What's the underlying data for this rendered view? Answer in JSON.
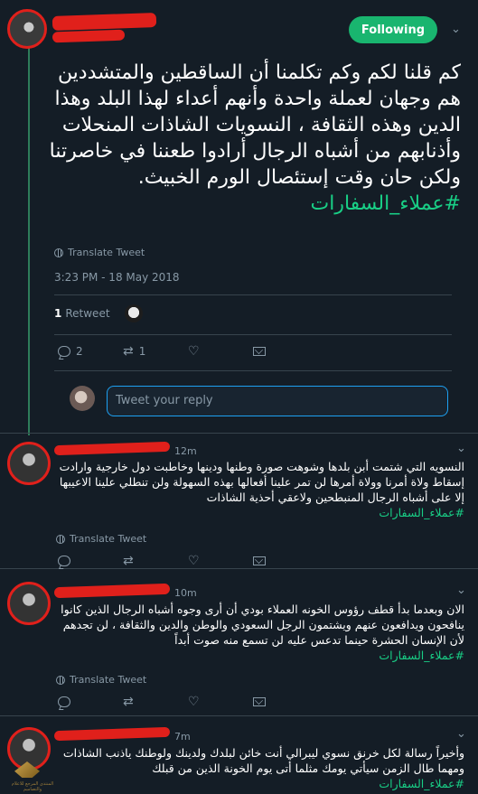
{
  "main_tweet": {
    "follow_label": "Following",
    "text": "كم قلنا لكم وكم تكلمنا أن الساقطين والمتشددين هم وجهان لعملة واحدة وأنهم أعداء لهذا البلد وهذا الدين وهذه الثقافة ، النسويات الشاذات المنحلات وأذنابهم من أشباه الرجال أرادوا طعننا في خاصرتنا ولكن حان وقت إستئصال الورم الخبيث.",
    "hashtag": "#عملاء_السفارات",
    "translate_label": "Translate Tweet",
    "timestamp": "3:23 PM - 18 May 2018",
    "retweet_count": "1",
    "retweet_label": "Retweet",
    "reply_count": "2",
    "retweet_action_count": "1",
    "reply_placeholder": "Tweet your reply"
  },
  "replies": [
    {
      "time": "12m",
      "text": "النسويه التي شتمت أبن بلدها وشوهت صورة وطنها ودينها وخاطبت دول خارجية وارادت إسقاط ولاة أمرنا وولاة أمرها لن تمر علينا أفعالها بهذه السهولة ولن تنطلي علينا الاعيبها إلا على أشباه الرجال المنبطحين ولاعقي أحذية الشاذات",
      "hashtag": "#عملاء_السفارات",
      "translate_label": "Translate Tweet"
    },
    {
      "time": "10m",
      "text": "الان وبعدما بدأ قطف رؤوس الخونه العملاء بودي أن أرى وجوه أشباه الرجال الذين كانوا ينافحون ويدافعون عنهم ويشتمون الرجل السعودي والوطن والدين والثقافة ، لن تجدهم لأن الإنسان الحشرة حينما تدعس عليه لن تسمع منه صوت أبداً",
      "hashtag": "#عملاء_السفارات",
      "translate_label": "Translate Tweet"
    },
    {
      "time": "7m",
      "text": "وأخيراً رسالة لكل خرنق نسوي ليبرالي أنت خائن لبلدك ولدينك ولوطنك ياذنب الشاذات ومهما طال الزمن سيأتي يومك مثلما أتى يوم الخونة الذين من قبلك",
      "hashtag": "#عملاء_السفارات"
    }
  ],
  "watermark_text": "المنتدى المرجع للاعلام والتصاميم",
  "colors": {
    "background": "#141d26",
    "accent": "#19cf86",
    "follow_button": "#19b56f",
    "muted": "#8899a6",
    "redaction": "#e0201b"
  },
  "icons": [
    "reply-icon",
    "retweet-icon",
    "heart-icon",
    "direct-message-icon",
    "globe-icon",
    "chevron-down-icon"
  ]
}
